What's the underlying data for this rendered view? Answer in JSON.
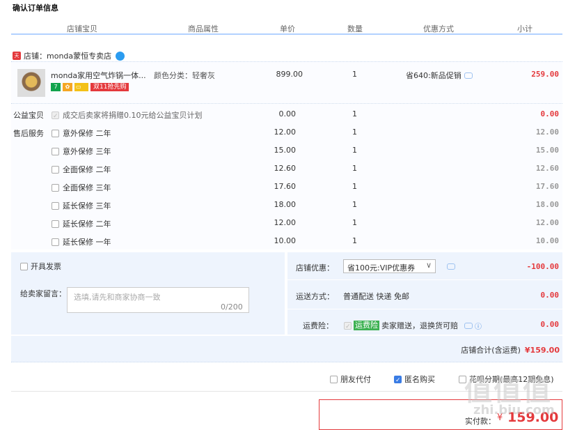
{
  "page_title": "确认订单信息",
  "columns": [
    "店铺宝贝",
    "商品属性",
    "单价",
    "数量",
    "优惠方式",
    "小计"
  ],
  "shop": {
    "name": "店铺：monda蒙恒专卖店",
    "badge_icon": "tmall-shop-icon"
  },
  "product": {
    "name": "monda家用空气炸锅一体...",
    "attr": "颜色分类：轻奢灰",
    "price": "899.00",
    "qty": "1",
    "promo": "省640:新品促销",
    "subtotal": "259.00",
    "badges": [
      "7",
      "",
      "",
      "双11抢先购"
    ]
  },
  "charity": {
    "label": "公益宝贝",
    "text": "成交后卖家将捐赠0.10元给公益宝贝计划",
    "price": "0.00",
    "qty": "1",
    "subtotal": "0.00"
  },
  "service_label": "售后服务",
  "services": [
    {
      "name": "意外保修 二年",
      "price": "12.00",
      "qty": "1",
      "subtotal": "12.00"
    },
    {
      "name": "意外保修 三年",
      "price": "15.00",
      "qty": "1",
      "subtotal": "15.00"
    },
    {
      "name": "全面保修 二年",
      "price": "12.60",
      "qty": "1",
      "subtotal": "12.60"
    },
    {
      "name": "全面保修 三年",
      "price": "17.60",
      "qty": "1",
      "subtotal": "17.60"
    },
    {
      "name": "延长保修 三年",
      "price": "18.00",
      "qty": "1",
      "subtotal": "18.00"
    },
    {
      "name": "延长保修 二年",
      "price": "12.00",
      "qty": "1",
      "subtotal": "12.00"
    },
    {
      "name": "延长保修 一年",
      "price": "10.00",
      "qty": "1",
      "subtotal": "10.00"
    }
  ],
  "invoice_label": "开具发票",
  "message": {
    "label": "给卖家留言：",
    "placeholder": "选填,请先和商家协商一致",
    "count": "0/200"
  },
  "store_discount": {
    "label": "店铺优惠：",
    "selected": "省100元:VIP优惠券",
    "amount": "-100.00"
  },
  "shipping": {
    "label": "运送方式：",
    "value": "普通配送 快递 免邮",
    "amount": "0.00"
  },
  "insurance": {
    "label": "运费险：",
    "tag": "运费险",
    "text": "卖家赠送，退换货可赔",
    "amount": "0.00"
  },
  "store_total": {
    "label": "店铺合计(含运费)",
    "value": "¥159.00"
  },
  "options": {
    "friend_pay": "朋友代付",
    "anonymous": "匿名购买",
    "installment": "花呗分期(最高12期免息)"
  },
  "payment": {
    "label": "实付款：",
    "currency": "¥",
    "value": "159.00"
  },
  "watermark": {
    "main": "值值值",
    "sub": "zhi.biu.com"
  }
}
